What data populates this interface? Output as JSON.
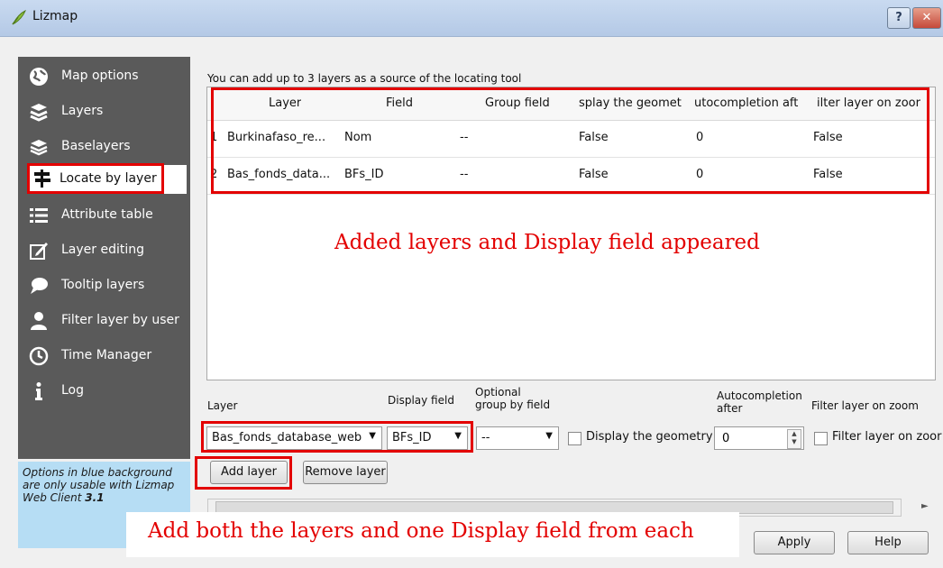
{
  "window": {
    "title": "Lizmap",
    "help_label": "?",
    "close_label": "✕"
  },
  "sidebar": {
    "items": [
      {
        "label": "Map options",
        "icon": "globe-icon"
      },
      {
        "label": "Layers",
        "icon": "layers-icon"
      },
      {
        "label": "Baselayers",
        "icon": "baselayers-icon"
      },
      {
        "label": "Locate by layer",
        "icon": "signpost-icon",
        "selected": true
      },
      {
        "label": "Attribute table",
        "icon": "list-icon"
      },
      {
        "label": "Layer editing",
        "icon": "edit-icon"
      },
      {
        "label": "Tooltip layers",
        "icon": "speech-bubble-icon"
      },
      {
        "label": "Filter layer by user",
        "icon": "user-icon"
      },
      {
        "label": "Time Manager",
        "icon": "clock-icon"
      },
      {
        "label": "Log",
        "icon": "info-icon"
      }
    ],
    "note_line1": "Options in blue background",
    "note_line2": "are only usable with Lizmap",
    "note_line3": "Web Client ",
    "note_version": "3.1"
  },
  "main": {
    "hint": "You can add up to 3 layers as a source of the locating tool",
    "table": {
      "headers": [
        "Layer",
        "Field",
        "Group field",
        "splay the geomet",
        "utocompletion aft",
        "ilter layer on zoor"
      ],
      "rows": [
        {
          "num": "1",
          "cells": [
            "Burkinafaso_re...",
            "Nom",
            "--",
            "False",
            "0",
            "False"
          ]
        },
        {
          "num": "2",
          "cells": [
            "Bas_fonds_data...",
            "BFs_ID",
            "--",
            "False",
            "0",
            "False"
          ]
        }
      ]
    },
    "form": {
      "layer_label": "Layer",
      "display_field_label": "Display field",
      "optional_line1": "Optional",
      "optional_line2": "group by field",
      "autocompletion_line1": "Autocompletion",
      "autocompletion_line2": "after",
      "filter_label": "Filter layer on zoom",
      "layer_value": "Bas_fonds_database_web",
      "display_field_value": "BFs_ID",
      "group_value": "--",
      "display_geometry_label": "Display the geometry",
      "autocompletion_value": "0",
      "filter_checkbox_label": "Filter layer on zoor",
      "add_layer_label": "Add layer",
      "remove_layer_label": "Remove layer",
      "apply_label": "Apply",
      "help_label": "Help"
    }
  },
  "annotations": {
    "top": "Added layers and Display field appeared",
    "bottom": "Add both the layers and one Display field from each"
  },
  "colors": {
    "annotation_red": "#e30000",
    "sidebar_bg": "#5a5a5a",
    "note_bg": "#b6ddf4"
  }
}
